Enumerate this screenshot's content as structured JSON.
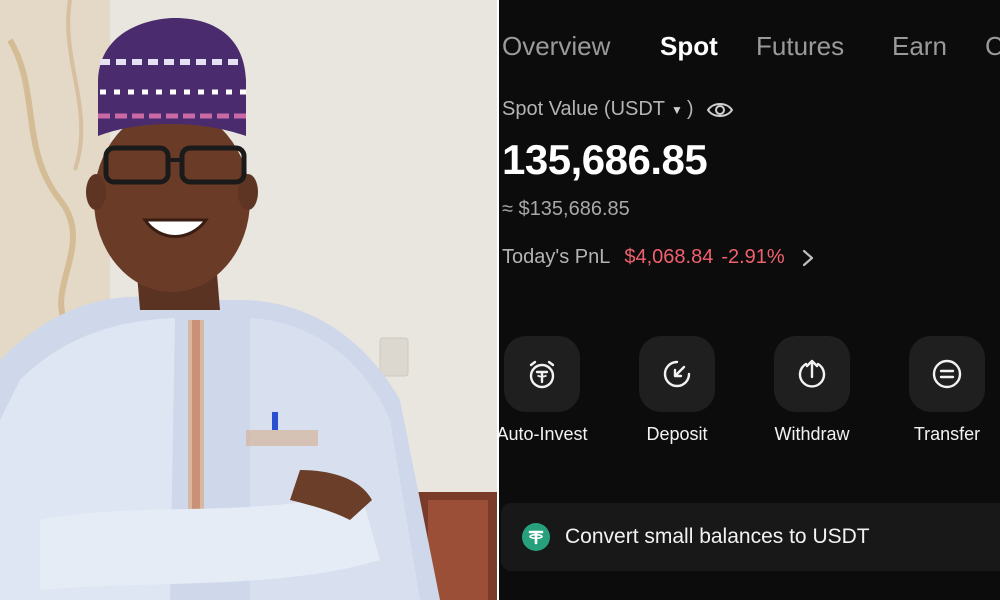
{
  "tabs": [
    {
      "label": "Overview",
      "active": false
    },
    {
      "label": "Spot",
      "active": true
    },
    {
      "label": "Futures",
      "active": false
    },
    {
      "label": "Earn",
      "active": false
    },
    {
      "label": "C",
      "active": false
    }
  ],
  "spot_value": {
    "label": "Spot Value (USDT",
    "label_close": ")",
    "currency_dropdown_icon": "caret-down-icon",
    "visibility_icon": "eye-icon",
    "amount": "135,686.85",
    "approx": "≈ $135,686.85"
  },
  "pnl": {
    "label": "Today's PnL",
    "amount": "$4,068.84",
    "percent": "-2.91%",
    "color": "#f0616d",
    "more_icon": "chevron-right-icon"
  },
  "actions": [
    {
      "label": "Auto-Invest",
      "icon": "auto-invest-icon"
    },
    {
      "label": "Deposit",
      "icon": "deposit-icon"
    },
    {
      "label": "Withdraw",
      "icon": "withdraw-icon"
    },
    {
      "label": "Transfer",
      "icon": "transfer-icon"
    }
  ],
  "convert_banner": {
    "text": "Convert small balances to USDT",
    "icon": "usdt-icon",
    "icon_color": "#26a17b"
  },
  "colors": {
    "app_background": "#0c0c0c",
    "negative": "#f0616d",
    "tab_inactive": "#9a9a9a"
  }
}
